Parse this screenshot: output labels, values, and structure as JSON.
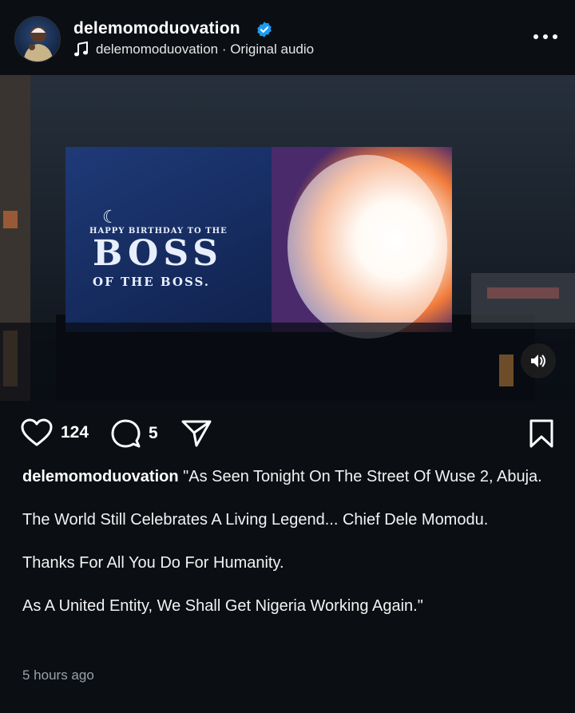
{
  "header": {
    "username": "delemomoduovation",
    "verified": true,
    "audio_text": "delemomoduovation · Original audio",
    "icons": {
      "avatar": "profile-avatar",
      "verified": "verified-badge-icon",
      "audio": "music-note-icon",
      "more": "more-options-icon"
    }
  },
  "media": {
    "type": "video",
    "billboard_text": {
      "line1": "HAPPY BIRTHDAY TO THE",
      "line2": "BOSS",
      "line3": "OF THE BOSS."
    },
    "sound_icon": "speaker-icon"
  },
  "actions": {
    "likes": "124",
    "comments": "5",
    "icons": [
      "heart-icon",
      "comment-icon",
      "share-icon",
      "bookmark-icon"
    ]
  },
  "caption": {
    "username": "delemomoduovation",
    "paragraphs": [
      "\"As Seen Tonight On The Street Of Wuse 2, Abuja.",
      "The World Still Celebrates A Living Legend... Chief Dele Momodu.",
      "Thanks For All You Do For Humanity.",
      "As A United Entity, We Shall Get Nigeria Working Again.\""
    ]
  },
  "timestamp": "5 hours ago",
  "colors": {
    "background": "#0b0f14",
    "verified_blue": "#1d9bf0",
    "text": "#f5f5f5",
    "muted": "#9aa0a6"
  }
}
